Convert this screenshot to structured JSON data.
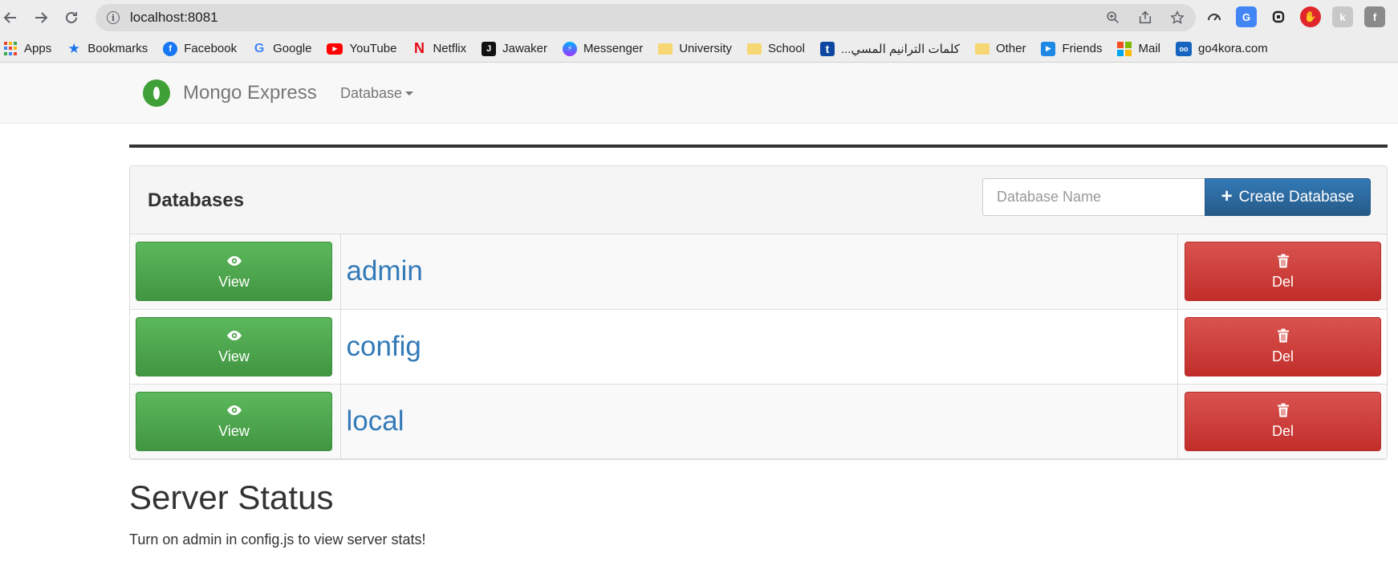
{
  "browser": {
    "url": "localhost:8081",
    "bookmarks": [
      {
        "label": "Apps",
        "icon": "apps-grid-icon"
      },
      {
        "label": "Bookmarks",
        "icon": "star-icon"
      },
      {
        "label": "Facebook",
        "icon": "facebook-icon"
      },
      {
        "label": "Google",
        "icon": "google-icon"
      },
      {
        "label": "YouTube",
        "icon": "youtube-icon"
      },
      {
        "label": "Netflix",
        "icon": "netflix-icon"
      },
      {
        "label": "Jawaker",
        "icon": "jawaker-icon"
      },
      {
        "label": "Messenger",
        "icon": "messenger-icon"
      },
      {
        "label": "University",
        "icon": "folder-icon"
      },
      {
        "label": "School",
        "icon": "folder-icon"
      },
      {
        "label": "...كلمات الترانيم المسي",
        "icon": "t-icon"
      },
      {
        "label": "Other",
        "icon": "folder-icon"
      },
      {
        "label": "Friends",
        "icon": "friends-icon"
      },
      {
        "label": "Mail",
        "icon": "microsoft-icon"
      },
      {
        "label": "go4kora.com",
        "icon": "go4kora-icon"
      }
    ]
  },
  "navbar": {
    "brand": "Mongo Express",
    "database_menu": "Database"
  },
  "databases": {
    "title": "Databases",
    "input_placeholder": "Database Name",
    "create_label": "Create Database",
    "view_label": "View",
    "del_label": "Del",
    "rows": [
      {
        "name": "admin"
      },
      {
        "name": "config"
      },
      {
        "name": "local"
      }
    ]
  },
  "server_status": {
    "title": "Server Status",
    "note": "Turn on admin in config.js to view server stats!"
  },
  "colors": {
    "view_green": "#5cb85c",
    "del_red": "#d9534f",
    "create_blue": "#337ab7",
    "link_blue": "#337ab7",
    "brand_green": "#3fa037"
  }
}
